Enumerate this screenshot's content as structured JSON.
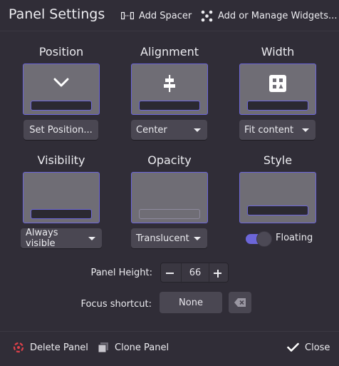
{
  "header": {
    "title": "Panel Settings",
    "add_spacer_label": "Add Spacer",
    "add_widgets_label": "Add or Manage Widgets..."
  },
  "sections": {
    "position": {
      "label": "Position",
      "button_label": "Set Position..."
    },
    "alignment": {
      "label": "Alignment",
      "value": "Center"
    },
    "width": {
      "label": "Width",
      "value": "Fit content"
    },
    "visibility": {
      "label": "Visibility",
      "value": "Always visible"
    },
    "opacity": {
      "label": "Opacity",
      "value": "Translucent"
    },
    "style": {
      "label": "Style",
      "toggle_label": "Floating",
      "floating": true
    }
  },
  "panel_height": {
    "label": "Panel Height:",
    "value": "66"
  },
  "focus_shortcut": {
    "label": "Focus shortcut:",
    "value": "None"
  },
  "footer": {
    "delete_label": "Delete Panel",
    "clone_label": "Clone Panel",
    "close_label": "Close"
  },
  "colors": {
    "accent": "#6c66d8",
    "background": "#302d37",
    "button": "#4a4752",
    "preview": "#6f6d75",
    "delete_icon": "#e0404a"
  },
  "icons": {
    "add_spacer": "spacer-icon",
    "add_widgets": "widgets-icon",
    "position_glyph": "chevron-down-icon",
    "alignment_glyph": "align-center-icon",
    "width_glyph": "fit-content-icon",
    "clear_shortcut": "backspace-icon",
    "delete": "delete-icon",
    "clone": "clone-icon",
    "close": "checkmark-icon"
  }
}
